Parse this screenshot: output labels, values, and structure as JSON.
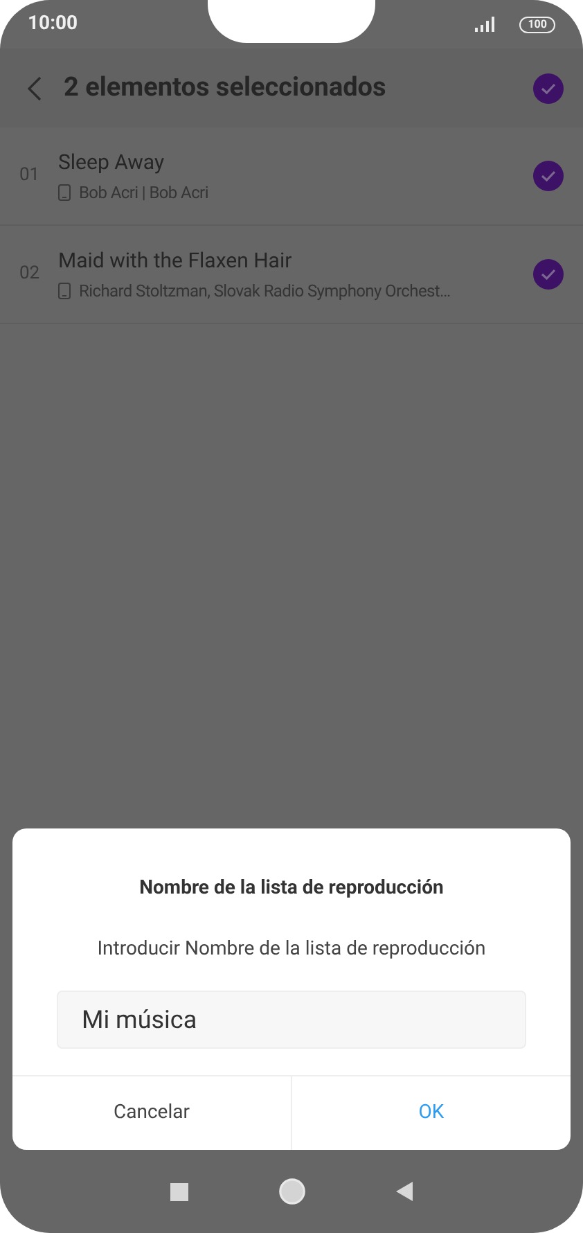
{
  "status_bar": {
    "time": "10:00",
    "battery": "100"
  },
  "header": {
    "title": "2 elementos seleccionados",
    "all_checked": true
  },
  "songs": [
    {
      "number": "01",
      "title": "Sleep Away",
      "artist": "Bob Acri | Bob Acri",
      "checked": true
    },
    {
      "number": "02",
      "title": "Maid with the Flaxen Hair",
      "artist": "Richard Stoltzman, Slovak Radio Symphony Orchest…",
      "checked": true
    }
  ],
  "dialog": {
    "title": "Nombre de la lista de reproducción",
    "message": "Introducir Nombre de la lista de reproducción",
    "value": "Mi música",
    "buttons": [
      {
        "label": "Cancelar",
        "kind": "cancel"
      },
      {
        "label": "OK",
        "kind": "primary"
      }
    ]
  }
}
